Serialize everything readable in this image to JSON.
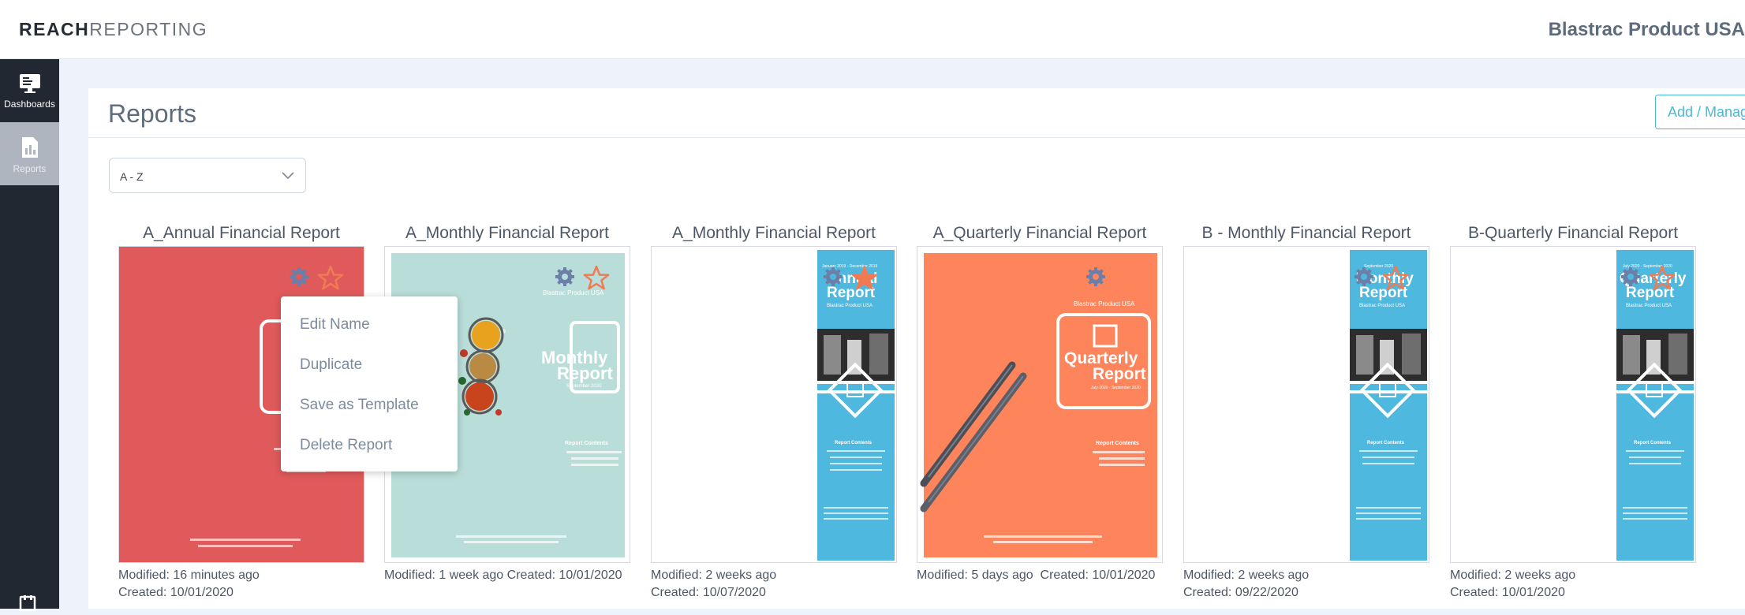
{
  "header": {
    "logo_bold": "REACH",
    "logo_light": "REPORTING",
    "company": "Blastrac Product USA"
  },
  "sidebar": {
    "items": [
      {
        "label": "Dashboards",
        "icon": "monitor-icon"
      },
      {
        "label": "Reports",
        "icon": "report-chart-icon"
      }
    ]
  },
  "main": {
    "title": "Reports",
    "add_button": "Add / Manage",
    "sort": {
      "selected": "A - Z"
    }
  },
  "cards": [
    {
      "title": "A_Annual Financial Report",
      "modified": "Modified: 16 minutes ago",
      "created": "Created: 10/01/2020",
      "theme": "red"
    },
    {
      "title": "A_Monthly Financial Report",
      "modified": "Modified: 1 week ago",
      "created": "Created: 10/01/2020",
      "theme": "mint",
      "cover": {
        "company": "Blastrac Product USA",
        "line1": "Monthly",
        "line2": "Report",
        "period": "September 2020",
        "contents": "Report Contents"
      }
    },
    {
      "title": "A_Monthly Financial Report",
      "modified": "Modified: 2 weeks ago",
      "created": "Created: 10/07/2020",
      "theme": "blue",
      "cover": {
        "period": "January 2019 - December 2019",
        "line1": "Annual",
        "line2": "Report",
        "company": "Blastrac Product USA",
        "contents": "Report Contents"
      }
    },
    {
      "title": "A_Quarterly Financial Report",
      "modified": "Modified: 5 days ago",
      "created": "Created: 10/01/2020",
      "theme": "orange",
      "cover": {
        "company": "Blastrac Product USA",
        "line1": "Quarterly",
        "line2": "Report",
        "period": "July 2020 - September 2020",
        "contents": "Report Contents"
      }
    },
    {
      "title": "B - Monthly Financial Report",
      "modified": "Modified: 2 weeks ago",
      "created": "Created: 09/22/2020",
      "theme": "blue",
      "cover": {
        "period": "September 2020",
        "line1": "Monthly",
        "line2": "Report",
        "company": "Blastrac Product USA",
        "contents": "Report Contents"
      }
    },
    {
      "title": "B-Quarterly Financial Report",
      "modified": "Modified: 2 weeks ago",
      "created": "Created: 10/01/2020",
      "theme": "blue",
      "cover": {
        "period": "July 2020 - September 2020",
        "line1": "Quarterly",
        "line2": "Report",
        "company": "Blastrac Product USA",
        "contents": "Report Contents"
      }
    }
  ],
  "context_menu": {
    "items": [
      "Edit Name",
      "Duplicate",
      "Save as Template",
      "Delete Report"
    ]
  },
  "colors": {
    "accent": "#49b9d9",
    "sidebar": "#222831",
    "red_cover": "#e05a5c",
    "mint_cover": "#b9ddd8",
    "blue_cover": "#4fb8de",
    "orange_cover": "#fd845b",
    "gear": "#6b7fa8",
    "star": "#f07b52"
  }
}
